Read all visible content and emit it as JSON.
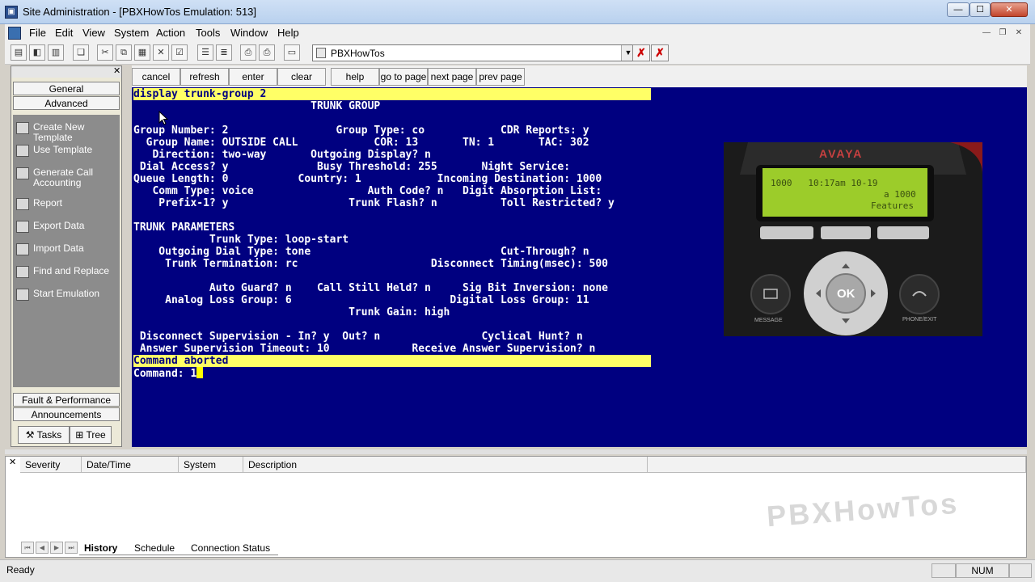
{
  "window": {
    "title": "Site Administration - [PBXHowTos Emulation: 513]",
    "min": "—",
    "max": "☐",
    "close": "✕"
  },
  "menu": {
    "items": [
      "File",
      "Edit",
      "View",
      "System",
      "Action",
      "Tools",
      "Window",
      "Help"
    ]
  },
  "toolbar": {
    "session": "PBXHowTos"
  },
  "left_panel": {
    "top_tabs": [
      "General",
      "Advanced"
    ],
    "tasks": [
      "Create New Template",
      "Use Template",
      "Generate Call Accounting",
      "Report",
      "Export Data",
      "Import Data",
      "Find and Replace",
      "Start Emulation"
    ],
    "bottom_tabs": [
      "Fault & Performance",
      "Announcements"
    ],
    "view_tabs": [
      "Tasks",
      "Tree"
    ]
  },
  "term_buttons": [
    "cancel",
    "refresh",
    "enter",
    "clear",
    "help",
    "go to page",
    "next page",
    "prev page"
  ],
  "terminal": {
    "lines": [
      "display trunk-group 2",
      "                            TRUNK GROUP",
      "",
      "Group Number: 2                 Group Type: co            CDR Reports: y",
      "  Group Name: OUTSIDE CALL            COR: 13       TN: 1       TAC: 302",
      "   Direction: two-way       Outgoing Display? n",
      " Dial Access? y              Busy Threshold: 255       Night Service:",
      "Queue Length: 0           Country: 1            Incoming Destination: 1000",
      "   Comm Type: voice                  Auth Code? n   Digit Absorption List:",
      "    Prefix-1? y                   Trunk Flash? n          Toll Restricted? y",
      "",
      "TRUNK PARAMETERS",
      "            Trunk Type: loop-start",
      "    Outgoing Dial Type: tone                              Cut-Through? n",
      "     Trunk Termination: rc                     Disconnect Timing(msec): 500",
      "",
      "            Auto Guard? n    Call Still Held? n     Sig Bit Inversion: none",
      "     Analog Loss Group: 6                         Digital Loss Group: 11",
      "                                  Trunk Gain: high",
      "",
      " Disconnect Supervision - In? y  Out? n                Cyclical Hunt? n",
      " Answer Supervision Timeout: 10             Receive Answer Supervision? n",
      "Command aborted",
      "Command: 1"
    ],
    "highlight_lines": [
      0,
      22
    ],
    "colors": {
      "background": "#000080",
      "text": "#ffffff",
      "highlight": "#ffff66"
    }
  },
  "phone": {
    "brand": "AVAYA",
    "screen_line1": "1000   10:17am 10-19",
    "screen_line2": "a 1000",
    "screen_line3": "Features",
    "ok": "OK",
    "message_label": "MESSAGE",
    "phone_exit_label": "PHONE/EXIT"
  },
  "log": {
    "columns": [
      "Severity",
      "Date/Time",
      "System",
      "Description"
    ],
    "tabs": [
      "History",
      "Schedule",
      "Connection Status"
    ],
    "active_tab": "History"
  },
  "watermark": "PBXHowTos",
  "status": {
    "text": "Ready",
    "num": "NUM"
  }
}
